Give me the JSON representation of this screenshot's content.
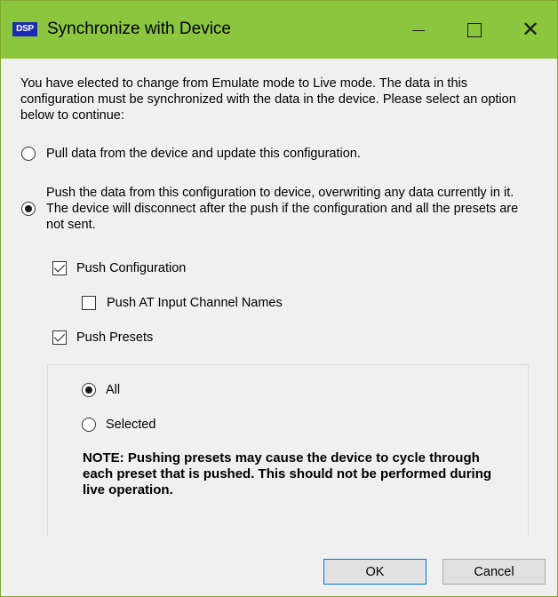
{
  "window": {
    "app_icon_text": "DSP",
    "title": "Synchronize with Device",
    "close_glyph": "✕"
  },
  "intro_text": "You have elected to change from Emulate mode to Live mode.  The data in this configuration must be synchronized with the data in the device.  Please select an option below to continue:",
  "options": {
    "pull_label": "Pull data from the device and update this configuration.",
    "pull_checked": false,
    "push_label": "Push the data from this configuration to device, overwriting any data currently in it.  The device will disconnect after the push if the configuration and all the presets are not sent.",
    "push_checked": true
  },
  "push_options": {
    "push_configuration_label": "Push Configuration",
    "push_configuration_checked": true,
    "push_at_input_label": "Push AT Input Channel Names",
    "push_at_input_checked": false,
    "push_presets_label": "Push Presets",
    "push_presets_checked": true
  },
  "presets": {
    "all_label": "All",
    "all_checked": true,
    "selected_label": "Selected",
    "selected_checked": false,
    "note": "NOTE: Pushing presets may cause the device to cycle through each preset that is pushed.  This should not be performed during live operation."
  },
  "buttons": {
    "ok_label": "OK",
    "cancel_label": "Cancel"
  },
  "colors": {
    "titlebar": "#8cc63f",
    "app_icon": "#1b2bb3",
    "default_button_border": "#0078d7"
  }
}
